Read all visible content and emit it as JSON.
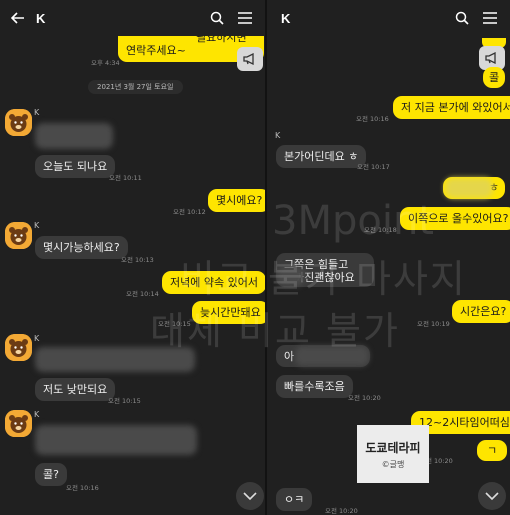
{
  "left": {
    "title": "K",
    "top_snippet_line1": "필요하시면",
    "top_snippet_line2": "연락주세요~",
    "top_time": "오후 4:34",
    "date": "2021년 3월 27일 토요일",
    "messages": {
      "m1_sender": "K",
      "m1_text": "오늘도 되나요",
      "m1_time": "오전 10:11",
      "m2_text": "몇시에요?",
      "m2_time": "오전 10:12",
      "m3_sender": "K",
      "m3_text": "몇시가능하세요?",
      "m3_time": "오전 10:13",
      "m4_text": "저녁에 약속 있어서",
      "m4_time": "오전 10:14",
      "m5_text": "늦시간만돼요",
      "m5_time": "오전 10:15",
      "m6_sender": "K",
      "m6_text": "저도 낮만되요",
      "m6_time": "오전 10:15",
      "m7_sender": "K",
      "m7_text": "콜?",
      "m7_time": "오전 10:16"
    }
  },
  "right": {
    "title": "K",
    "top_reply": "콜",
    "messages": {
      "r1_text": "저 지금 본가에 와있어서",
      "r1_time": "오전 10:16",
      "r2_sender": "K",
      "r2_text": "본가어딘데요 ㅎ",
      "r2_time": "오전 10:17",
      "r3_text": "ㅎ",
      "r4_text": "이쪽으로 올수있어요?",
      "r4_time": "오전 10:18",
      "r5_line1": "그쪽은 힘들고",
      "r5_line2": "까진괜찮아요",
      "r6_text": "시간은요?",
      "r6_time": "오전 10:19",
      "r7_text": "아",
      "r8_text": "빠를수록조음",
      "r8_time": "오전 10:20",
      "r9_text": "12~2시타임어떠심",
      "r9_time": "오전 10:20",
      "r10_text": "ㄱ",
      "r11_text": "ㅇㅋ",
      "r11_time": "오전 10:20"
    }
  },
  "watermark": {
    "line1": "3Mpoint",
    "line2": "비교 불가 마사지",
    "line3": "대체 비교 불가"
  },
  "stamp": {
    "line1": "도쿄테라피",
    "line2": "©글맹"
  },
  "colors": {
    "outgoing": "#fee500",
    "incoming": "#3a3a3a",
    "background": "#202020"
  },
  "icons": [
    "back-arrow-icon",
    "search-icon",
    "menu-icon",
    "megaphone-icon",
    "chevron-down-icon",
    "avatar-icon"
  ]
}
